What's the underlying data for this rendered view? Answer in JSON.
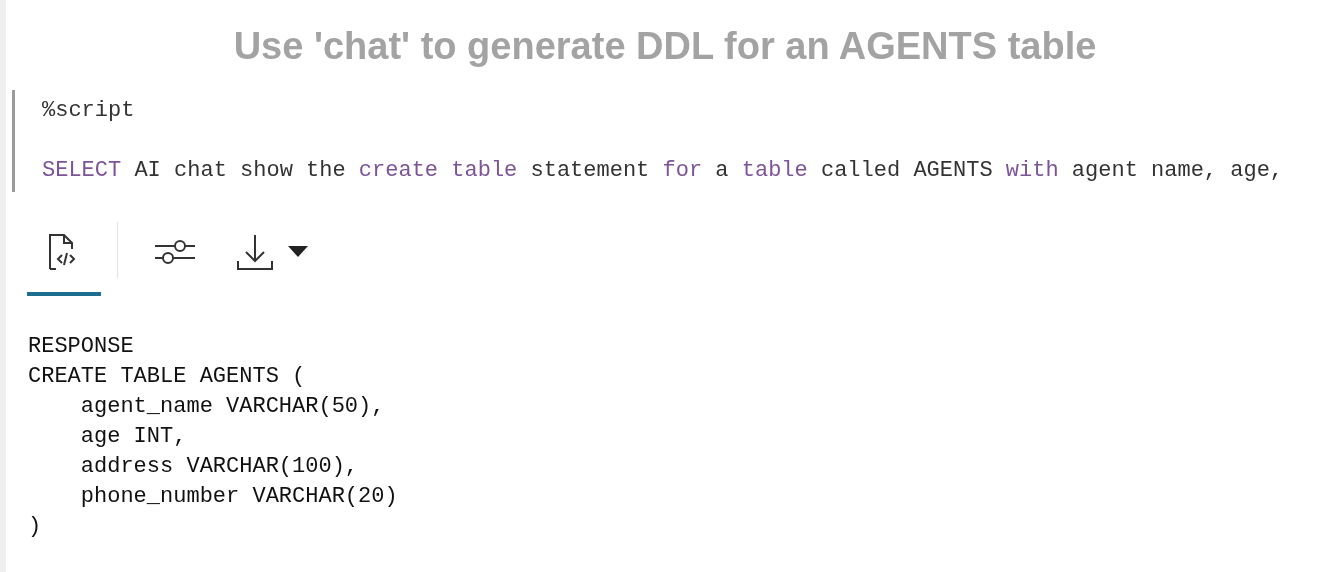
{
  "title": "Use 'chat' to generate DDL for an AGENTS table",
  "script_cell": {
    "directive": "%script",
    "tokens": [
      {
        "kind": "keyword",
        "text": "SELECT"
      },
      {
        "kind": "plain",
        "text": "AI chat show the"
      },
      {
        "kind": "keyword",
        "text": "create table"
      },
      {
        "kind": "plain",
        "text": "statement"
      },
      {
        "kind": "keyword",
        "text": "for"
      },
      {
        "kind": "plain",
        "text": "a"
      },
      {
        "kind": "keyword",
        "text": "table"
      },
      {
        "kind": "plain",
        "text": "called AGENTS"
      },
      {
        "kind": "keyword",
        "text": "with"
      },
      {
        "kind": "plain",
        "text": "agent name, age,"
      }
    ]
  },
  "result_tabs": [
    {
      "kind": "code",
      "selected": true
    },
    {
      "kind": "settings",
      "selected": false
    },
    {
      "kind": "download",
      "selected": false
    }
  ],
  "output_lines": [
    "RESPONSE",
    "CREATE TABLE AGENTS (",
    "    agent_name VARCHAR(50),",
    "    age INT,",
    "    address VARCHAR(100),",
    "    phone_number VARCHAR(20)",
    ")"
  ]
}
